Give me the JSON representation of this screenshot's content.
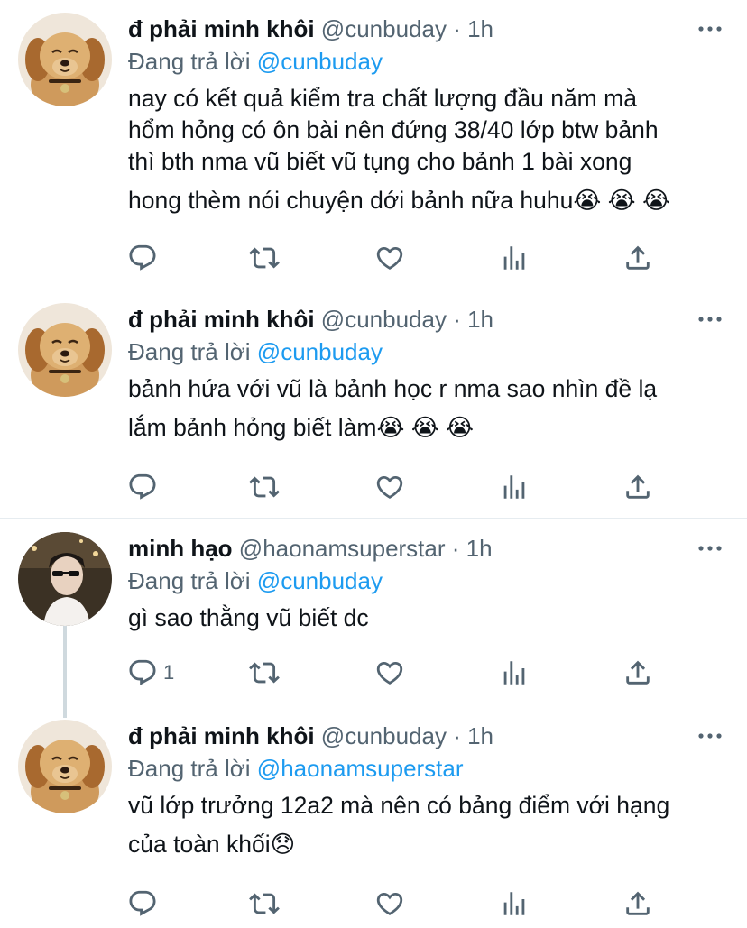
{
  "tweets": [
    {
      "name": "đ phải minh khôi",
      "handle": "@cunbuday",
      "dot": "·",
      "time": "1h",
      "replying_prefix": "Đang trả lời",
      "replying_to": "@cunbuday",
      "avatar": "golden-retriever-puppy",
      "lines": [
        "nay có kết quả kiểm tra chất lượng đầu năm mà",
        "hổm hỏng có ôn bài nên đứng 38/40 lớp btw bảnh",
        "thì bth nma vũ biết vũ tụng cho bảnh 1 bài xong",
        "hong thèm nói chuyện dới bảnh nữa huhu😭 😭 😭"
      ],
      "reply_count": ""
    },
    {
      "name": "đ phải minh khôi",
      "handle": "@cunbuday",
      "dot": "·",
      "time": "1h",
      "replying_prefix": "Đang trả lời",
      "replying_to": "@cunbuday",
      "avatar": "golden-retriever-puppy",
      "lines": [
        "bảnh hứa với vũ là bảnh học r nma sao nhìn đề lạ",
        "lắm bảnh hỏng biết làm😭 😭 😭"
      ],
      "reply_count": ""
    },
    {
      "name": "minh hạo",
      "handle": "@haonamsuperstar",
      "dot": "·",
      "time": "1h",
      "replying_prefix": "Đang trả lời",
      "replying_to": "@cunbuday",
      "avatar": "person-with-sunglasses",
      "lines": [
        "gì sao thằng vũ biết dc"
      ],
      "reply_count": "1"
    },
    {
      "name": "đ phải minh khôi",
      "handle": "@cunbuday",
      "dot": "·",
      "time": "1h",
      "replying_prefix": "Đang trả lời",
      "replying_to": "@haonamsuperstar",
      "avatar": "golden-retriever-puppy",
      "lines": [
        "vũ lớp trưởng 12a2 mà nên có bảng điểm với hạng",
        "của toàn khối😞"
      ],
      "reply_count": ""
    }
  ],
  "icons": {
    "reply": "reply-icon",
    "retweet": "retweet-icon",
    "like": "like-icon",
    "views": "views-icon",
    "share": "share-icon",
    "more": "more-icon"
  },
  "colors": {
    "text": "#0f1419",
    "secondary": "#536471",
    "accent": "#1d9bf0",
    "divider": "#e6ecf0"
  }
}
